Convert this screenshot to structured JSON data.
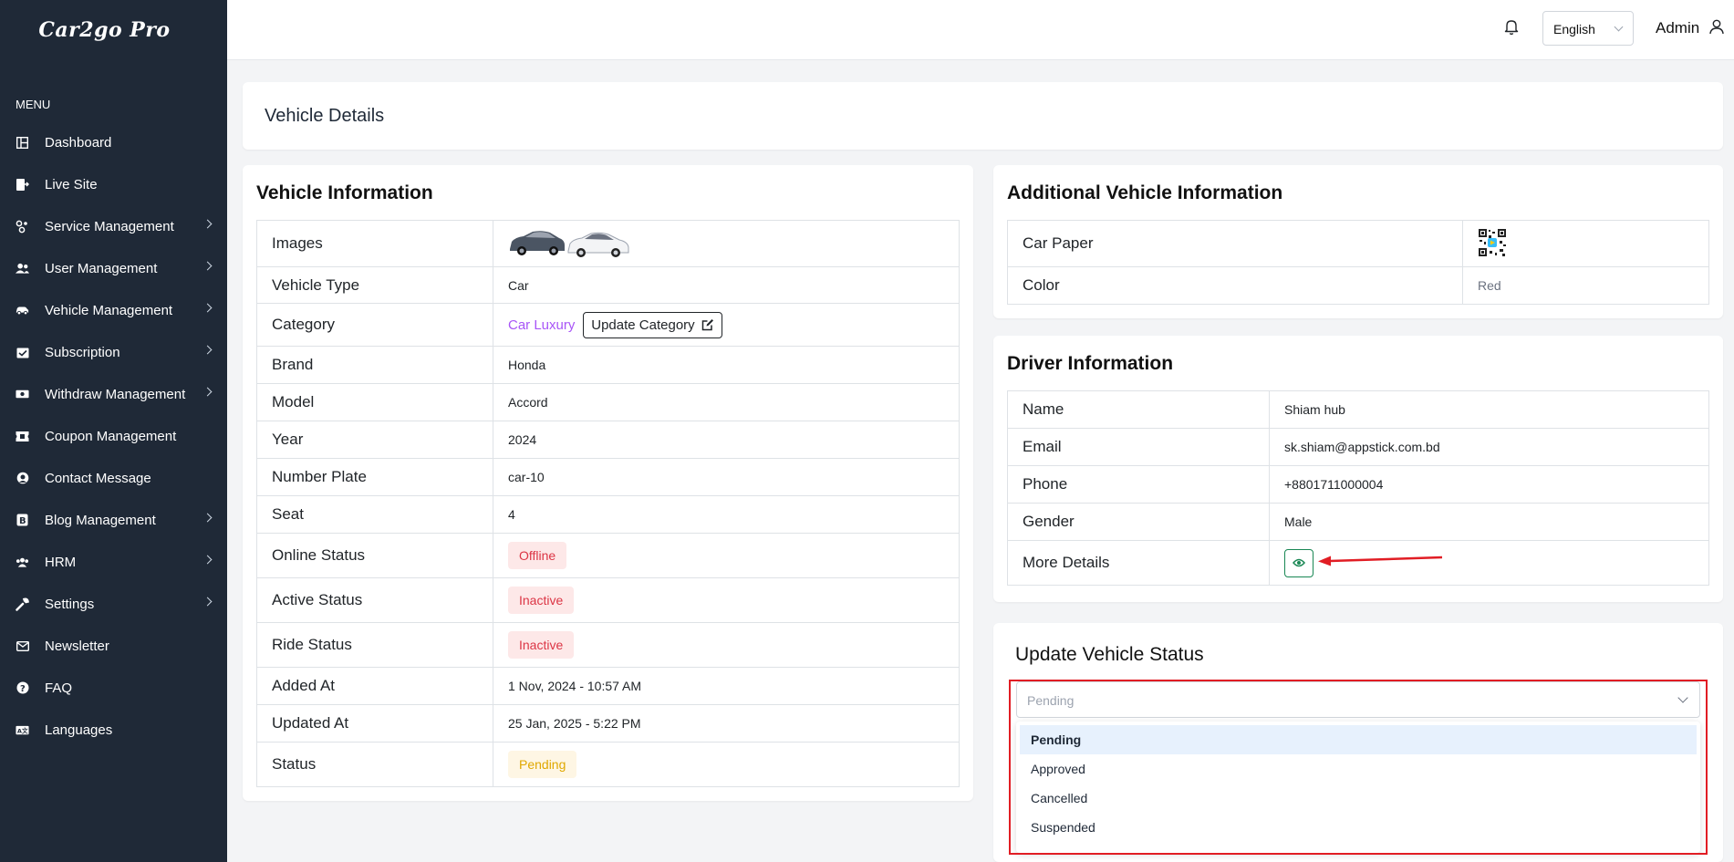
{
  "sidebar": {
    "logo": "Car2go Pro",
    "menu_heading": "MENU",
    "items": [
      {
        "label": "Dashboard",
        "icon": "dashboard-icon",
        "has_children": false
      },
      {
        "label": "Live Site",
        "icon": "external-site-icon",
        "has_children": false
      },
      {
        "label": "Service Management",
        "icon": "services-icon",
        "has_children": true
      },
      {
        "label": "User Management",
        "icon": "users-icon",
        "has_children": true
      },
      {
        "label": "Vehicle Management",
        "icon": "car-icon",
        "has_children": true
      },
      {
        "label": "Subscription",
        "icon": "subscription-icon",
        "has_children": true
      },
      {
        "label": "Withdraw Management",
        "icon": "money-icon",
        "has_children": true
      },
      {
        "label": "Coupon Management",
        "icon": "coupon-icon",
        "has_children": false
      },
      {
        "label": "Contact Message",
        "icon": "headset-icon",
        "has_children": false
      },
      {
        "label": "Blog Management",
        "icon": "blog-icon",
        "has_children": true
      },
      {
        "label": "HRM",
        "icon": "team-icon",
        "has_children": true
      },
      {
        "label": "Settings",
        "icon": "wrench-icon",
        "has_children": true
      },
      {
        "label": "Newsletter",
        "icon": "envelope-icon",
        "has_children": false
      },
      {
        "label": "FAQ",
        "icon": "question-icon",
        "has_children": false
      },
      {
        "label": "Languages",
        "icon": "language-icon",
        "has_children": false
      }
    ]
  },
  "topbar": {
    "language": "English",
    "user": "Admin"
  },
  "page": {
    "title": "Vehicle Details"
  },
  "vehicle_info": {
    "heading": "Vehicle Information",
    "rows": {
      "images": "Images",
      "vehicle_type_label": "Vehicle Type",
      "vehicle_type": "Car",
      "category_label": "Category",
      "category": "Car Luxury",
      "update_category": "Update Category",
      "brand_label": "Brand",
      "brand": "Honda",
      "model_label": "Model",
      "model": "Accord",
      "year_label": "Year",
      "year": "2024",
      "plate_label": "Number Plate",
      "plate": "car-10",
      "seat_label": "Seat",
      "seat": "4",
      "online_label": "Online Status",
      "online": "Offline",
      "active_label": "Active Status",
      "active": "Inactive",
      "ride_label": "Ride Status",
      "ride": "Inactive",
      "added_label": "Added At",
      "added": "1 Nov, 2024 - 10:57 AM",
      "updated_label": "Updated At",
      "updated": "25 Jan, 2025 - 5:22 PM",
      "status_label": "Status",
      "status": "Pending"
    }
  },
  "additional_info": {
    "heading": "Additional Vehicle Information",
    "paper_label": "Car Paper",
    "color_label": "Color",
    "color": "Red"
  },
  "driver_info": {
    "heading": "Driver Information",
    "name_label": "Name",
    "name": "Shiam hub",
    "email_label": "Email",
    "email": "sk.shiam@appstick.com.bd",
    "phone_label": "Phone",
    "phone": "+8801711000004",
    "gender_label": "Gender",
    "gender": "Male",
    "more_label": "More Details"
  },
  "update_status": {
    "heading": "Update Vehicle Status",
    "selected": "Pending",
    "options": [
      "Pending",
      "Approved",
      "Cancelled",
      "Suspended"
    ]
  },
  "colors": {
    "sidebar_bg": "#1f2937",
    "accent_purple": "#a855f7",
    "danger": "#dc3545",
    "warning": "#e0a800",
    "success": "#198754",
    "annotation_red": "#e11d24"
  }
}
